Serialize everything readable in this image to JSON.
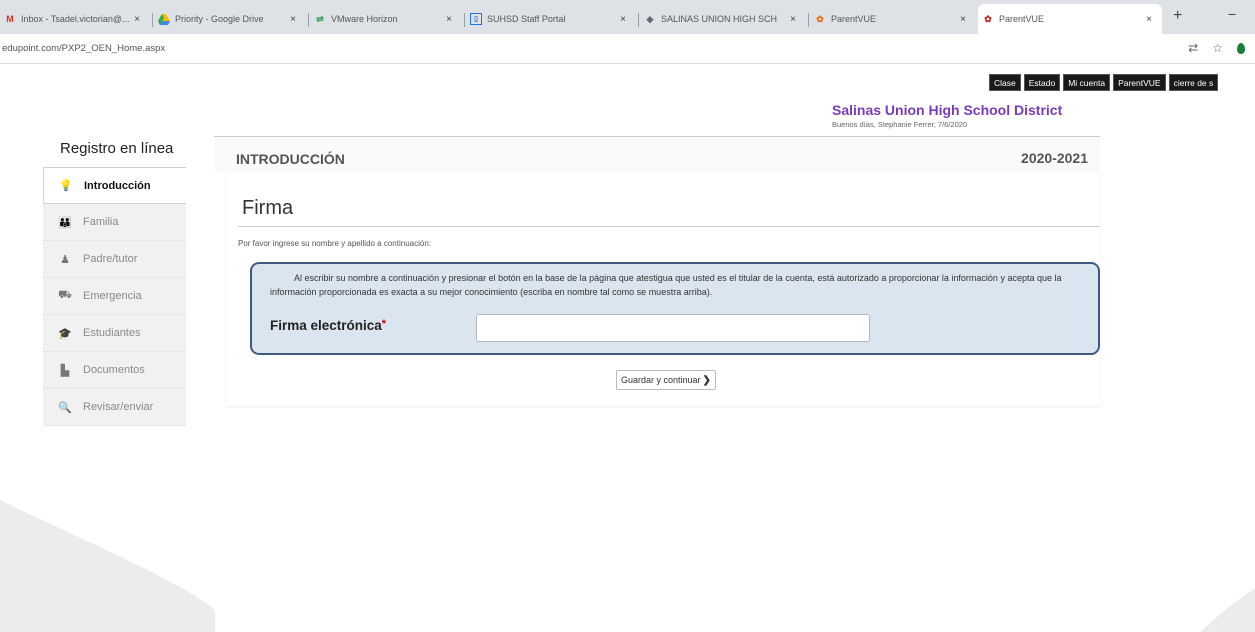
{
  "browser": {
    "tabs": [
      {
        "title": "Inbox - Tsadel.victorian@...",
        "icon": "gmail-icon"
      },
      {
        "title": "Priority - Google Drive",
        "icon": "google-drive-icon"
      },
      {
        "title": "VMware Horizon",
        "icon": "vmware-icon"
      },
      {
        "title": "SUHSD Staff Portal",
        "icon": "portal-icon"
      },
      {
        "title": "SALINAS UNION HIGH SCH",
        "icon": "school-icon"
      },
      {
        "title": "ParentVUE",
        "icon": "parentvue-icon"
      },
      {
        "title": "ParentVUE",
        "icon": "parentvue-icon"
      }
    ],
    "url": "edupoint.com/PXP2_OEN_Home.aspx",
    "new_tab_label": "+",
    "minimize_label": "−"
  },
  "topnav": {
    "items": [
      "Clase",
      "Estado",
      "Mi cuenta",
      "ParentVUE",
      "cierre de s"
    ]
  },
  "header": {
    "district": "Salinas Union High School District",
    "greeting": "Buenos días, Stephanie Ferrer, 7/6/2020"
  },
  "sidebar": {
    "title": "Registro en línea",
    "items": [
      {
        "label": "Introducción",
        "icon": "lightbulb-icon",
        "glyph": "💡"
      },
      {
        "label": "Familia",
        "icon": "family-icon",
        "glyph": "👪"
      },
      {
        "label": "Padre/tutor",
        "icon": "user-icon",
        "glyph": "♟"
      },
      {
        "label": "Emergencia",
        "icon": "emergency-icon",
        "glyph": "⛟"
      },
      {
        "label": "Estudiantes",
        "icon": "graduation-cap-icon",
        "glyph": "🎓"
      },
      {
        "label": "Documentos",
        "icon": "document-icon",
        "glyph": "▙"
      },
      {
        "label": "Revisar/enviar",
        "icon": "search-icon",
        "glyph": "🔍"
      }
    ]
  },
  "main": {
    "section_title": "INTRODUCCIÓN",
    "year": "2020-2021",
    "heading": "Firma",
    "instruction": "Por favor ingrese su nombre y apellido a continuación:",
    "notice": "Al escribir su nombre a continuación y presionar el botón en la base de la página que atestigua que usted es el titular de la cuenta, está autorizado a proporcionar la información y acepta que la información proporcionada es exacta a su mejor conocimiento (escriba en nombre tal como se muestra arriba).",
    "signature_label": "Firma electrónica",
    "required_mark": "*",
    "signature_value": "",
    "save_label": "Guardar y continuar",
    "save_chevron": "❯"
  },
  "colors": {
    "district": "#7a3bb8",
    "notice_bg": "#dbe5ef",
    "notice_border": "#3e5a82",
    "nav_bg": "#1a1a1a"
  }
}
